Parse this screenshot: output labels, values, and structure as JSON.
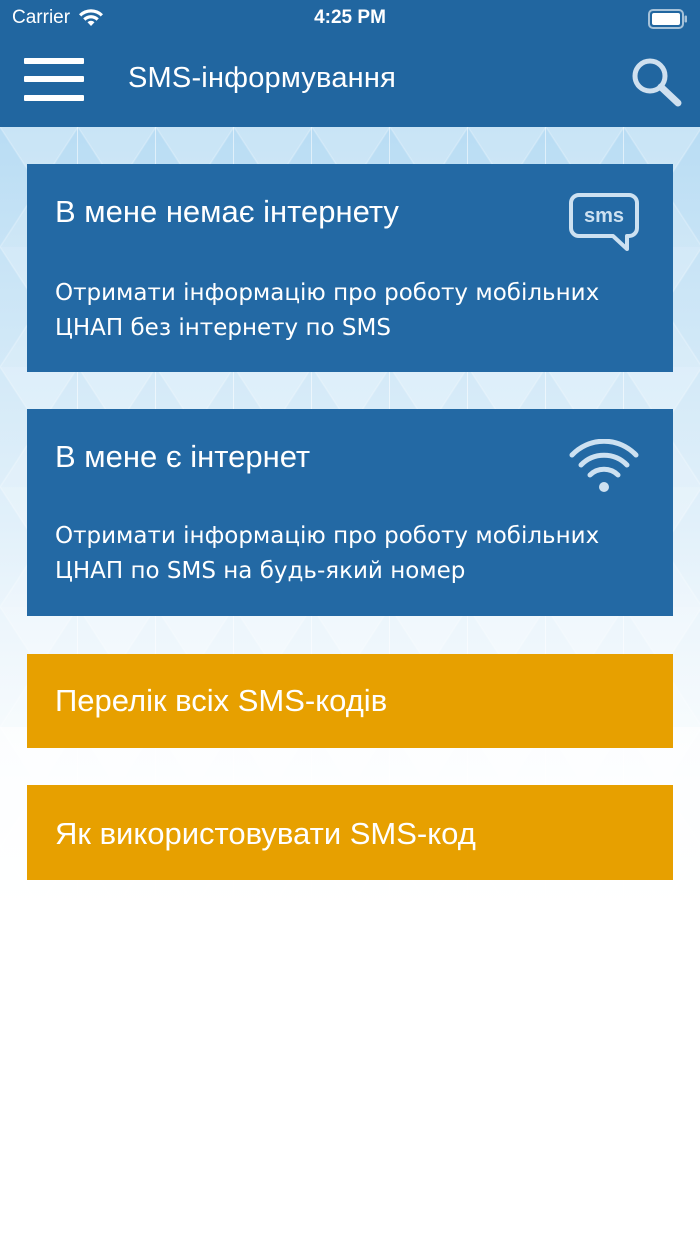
{
  "status_bar": {
    "carrier": "Carrier",
    "time": "4:25 PM",
    "wifi_icon": "wifi-icon",
    "battery_icon": "battery-icon"
  },
  "header": {
    "menu_icon": "hamburger-menu-icon",
    "title": "SMS-інформування",
    "search_icon": "search-icon"
  },
  "cards": [
    {
      "heading": "В мене немає інтернету",
      "description": "Отримати інформацію про роботу мобільних ЦНАП без інтернету по SMS",
      "icon": "sms-bubble-icon",
      "icon_text": "sms",
      "color": "#2369a4"
    },
    {
      "heading": "В мене є інтернет",
      "description": "Отримати інформацію про роботу мобільних ЦНАП по SMS на будь-який номер",
      "icon": "wifi-icon",
      "color": "#2369a4"
    },
    {
      "heading": "Перелік всіх SMS-кодів",
      "color": "#e7a000"
    },
    {
      "heading": "Як використовувати SMS-код",
      "color": "#e7a000"
    }
  ],
  "colors": {
    "header": "#2166a0",
    "card_blue": "#2369a4",
    "card_orange": "#e7a000"
  }
}
